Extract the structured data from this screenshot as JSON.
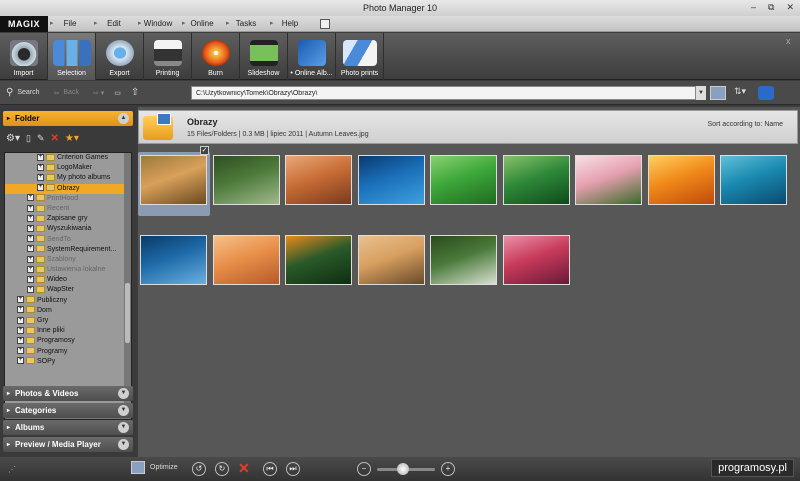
{
  "window": {
    "title": "Photo Manager 10",
    "controls": [
      "–",
      "⧉",
      "✕"
    ]
  },
  "menubar": {
    "logo": "MAGIX",
    "items": [
      "File",
      "Edit",
      "Window",
      "Online",
      "Tasks",
      "Help"
    ]
  },
  "toolbar": {
    "items": [
      {
        "label": "Import",
        "icon": "camera-icon"
      },
      {
        "label": "Selection",
        "icon": "selection-icon"
      },
      {
        "label": "Export",
        "icon": "export-icon"
      },
      {
        "label": "Printing",
        "icon": "printer-icon"
      },
      {
        "label": "Burn",
        "icon": "burn-icon"
      },
      {
        "label": "Slideshow",
        "icon": "slideshow-icon"
      },
      {
        "label": "• Online Alb...",
        "icon": "online-album-icon"
      },
      {
        "label": "Photo prints",
        "icon": "photo-prints-icon"
      }
    ],
    "close": "x"
  },
  "addressbar": {
    "search_label": "Search",
    "back_label": "Back",
    "path": "C:\\Użytkownicy\\Tomek\\Obrazy\\Obrazy\\"
  },
  "sidebar": {
    "folder_label": "Folder",
    "tree": [
      {
        "label": "Criterion Games",
        "indent": 3,
        "state": "normal"
      },
      {
        "label": "LogoMaker",
        "indent": 3,
        "state": "normal"
      },
      {
        "label": "My photo albums",
        "indent": 3,
        "state": "normal"
      },
      {
        "label": "Obrazy",
        "indent": 3,
        "state": "selected"
      },
      {
        "label": "PrintHood",
        "indent": 2,
        "state": "dim"
      },
      {
        "label": "Recent",
        "indent": 2,
        "state": "dim"
      },
      {
        "label": "Zapisane gry",
        "indent": 2,
        "state": "normal"
      },
      {
        "label": "Wyszukiwania",
        "indent": 2,
        "state": "normal"
      },
      {
        "label": "SendTo",
        "indent": 2,
        "state": "dim"
      },
      {
        "label": "SystemRequirement...",
        "indent": 2,
        "state": "normal"
      },
      {
        "label": "Szablony",
        "indent": 2,
        "state": "dim"
      },
      {
        "label": "Ustawienia lokalne",
        "indent": 2,
        "state": "dim"
      },
      {
        "label": "Wideo",
        "indent": 2,
        "state": "normal"
      },
      {
        "label": "WapSter",
        "indent": 2,
        "state": "normal"
      },
      {
        "label": "Publiczny",
        "indent": 1,
        "state": "normal"
      },
      {
        "label": "Dom",
        "indent": 1,
        "state": "normal"
      },
      {
        "label": "Gry",
        "indent": 1,
        "state": "normal"
      },
      {
        "label": "Inne pliki",
        "indent": 1,
        "state": "normal"
      },
      {
        "label": "Programosy",
        "indent": 1,
        "state": "normal"
      },
      {
        "label": "Programy",
        "indent": 1,
        "state": "normal"
      },
      {
        "label": "SOPy",
        "indent": 1,
        "state": "normal"
      }
    ],
    "panels": [
      "Photos & Videos",
      "Categories",
      "Albums",
      "Preview / Media Player"
    ]
  },
  "folder": {
    "title": "Obrazy",
    "info": "15 Files/Folders | 0.3 MB | lipiec 2011 | Autumn Leaves.jpg",
    "sort": "Sort according to: Name"
  },
  "thumbnails": [
    {
      "name": "autumn-leaves",
      "colors": [
        "#d9a05a",
        "#6b4a20",
        "#9b7a3a"
      ],
      "selected": true
    },
    {
      "name": "creek",
      "colors": [
        "#4d7a3a",
        "#9fb98a",
        "#2f4e22"
      ]
    },
    {
      "name": "desert-rocks",
      "colors": [
        "#c96d36",
        "#7a3a1c",
        "#e8a878"
      ]
    },
    {
      "name": "dock",
      "colors": [
        "#1a6fb8",
        "#3fa0e0",
        "#0a3a70"
      ]
    },
    {
      "name": "dew-leaf",
      "colors": [
        "#3da83a",
        "#1f6a20",
        "#8ad070"
      ]
    },
    {
      "name": "forest",
      "colors": [
        "#2f8a3a",
        "#0e4a1a",
        "#8ac06a"
      ]
    },
    {
      "name": "frangipani",
      "colors": [
        "#e6a0b0",
        "#3a6a2a",
        "#f6e0e4"
      ]
    },
    {
      "name": "garden",
      "colors": [
        "#f08a1a",
        "#c04a0a",
        "#ffd060"
      ]
    },
    {
      "name": "green-sea-turtle",
      "colors": [
        "#1a8ab0",
        "#0a4a70",
        "#60c0d8"
      ]
    },
    {
      "name": "humpback-whale",
      "colors": [
        "#1e6aa8",
        "#6ab0e0",
        "#0a3a68"
      ]
    },
    {
      "name": "oryx-antelope",
      "colors": [
        "#e8904a",
        "#b85a2a",
        "#f6c08a"
      ]
    },
    {
      "name": "toco-toucan",
      "colors": [
        "#2a5a2a",
        "#0e2e10",
        "#e88a1a"
      ]
    },
    {
      "name": "tree",
      "colors": [
        "#d8a060",
        "#6a4a2a",
        "#e8c090"
      ]
    },
    {
      "name": "waterfall",
      "colors": [
        "#4a7a3a",
        "#d8e0d0",
        "#2a4a1a"
      ]
    },
    {
      "name": "winter-leaves",
      "colors": [
        "#c83a5a",
        "#6a1a3a",
        "#e890a8"
      ]
    }
  ],
  "statusbar": {
    "optimize_label": "Optimize",
    "zoom_level": 0.45,
    "watermark": "programosy.pl"
  }
}
